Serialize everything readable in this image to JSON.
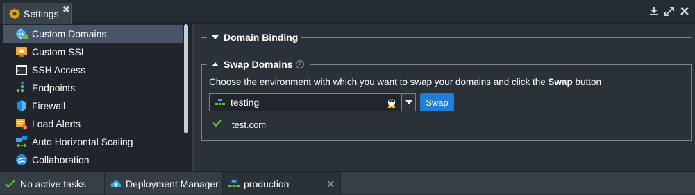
{
  "window": {
    "tab_title": "Settings",
    "tab_close": "✖"
  },
  "sidebar": {
    "items": [
      {
        "label": "Custom Domains",
        "icon": "custom-domains-icon",
        "active": true
      },
      {
        "label": "Custom SSL",
        "icon": "ssl-certificate-icon"
      },
      {
        "label": "SSH Access",
        "icon": "terminal-icon"
      },
      {
        "label": "Endpoints",
        "icon": "endpoints-icon"
      },
      {
        "label": "Firewall",
        "icon": "shield-icon"
      },
      {
        "label": "Load Alerts",
        "icon": "alert-icon"
      },
      {
        "label": "Auto Horizontal Scaling",
        "icon": "scaling-icon"
      },
      {
        "label": "Collaboration",
        "icon": "collaboration-icon"
      }
    ]
  },
  "main": {
    "domain_binding_title": "Domain Binding",
    "swap_domains_title": "Swap Domains",
    "help_glyph": "?",
    "description_prefix": "Choose the environment with which you want to swap your domains and click the ",
    "description_bold": "Swap",
    "description_suffix": " button",
    "environment_value": "testing",
    "swap_button_label": "Swap",
    "domains": [
      "test.com"
    ]
  },
  "bottombar": {
    "tasks_label": "No active tasks",
    "deployment_manager_label": "Deployment Manager",
    "production_label": "production",
    "close_glyph": "✕"
  },
  "colors": {
    "accent": "#1e7fd9",
    "active_item": "#475566",
    "success": "#5fbf3a"
  }
}
